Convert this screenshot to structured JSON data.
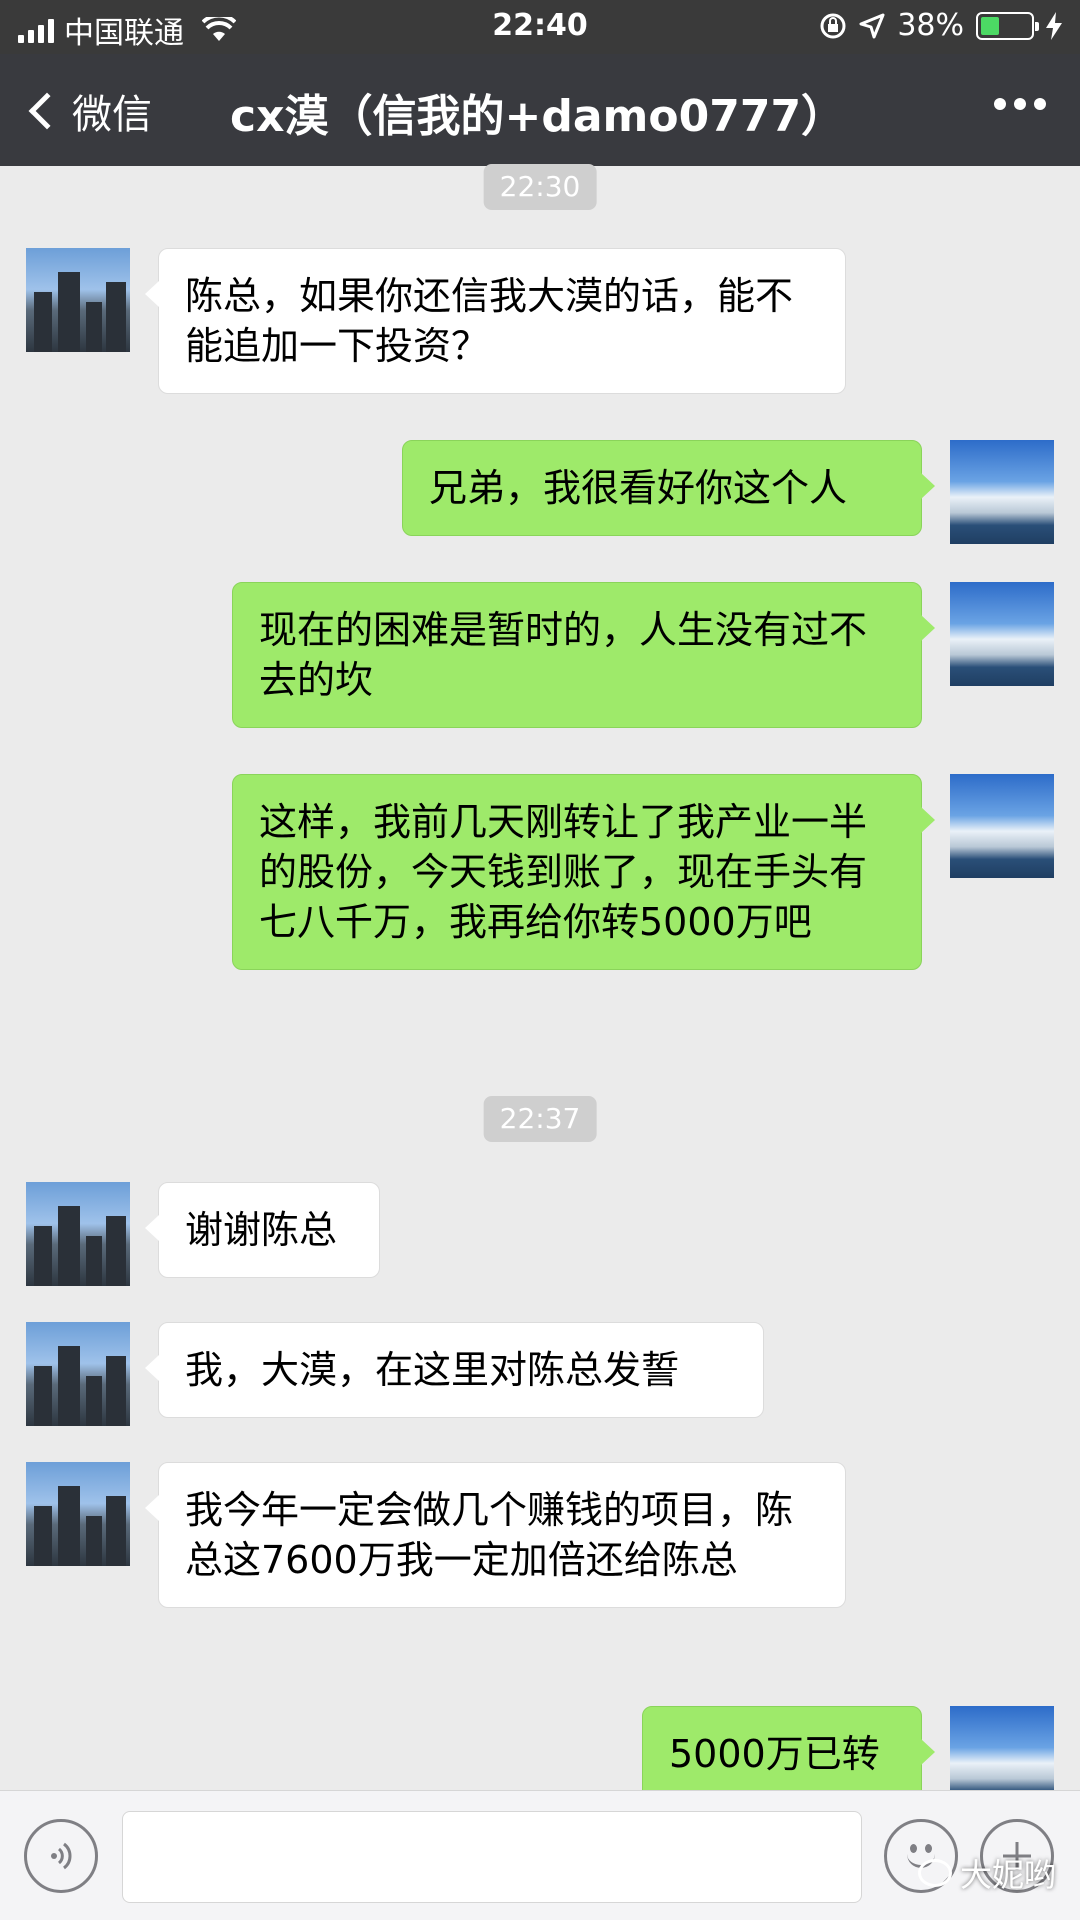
{
  "status_bar": {
    "carrier": "中国联通",
    "time": "22:40",
    "battery_percent": "38%",
    "battery_level": 0.38,
    "battery_color": "#4cd964"
  },
  "nav": {
    "back_label": "微信",
    "title": "cx漠（信我的+damo0777）"
  },
  "timestamps": [
    "22:30",
    "22:37"
  ],
  "messages": [
    {
      "side": "left",
      "text": "陈总，如果你还信我大漠的话，能不能追加一下投资？"
    },
    {
      "side": "right",
      "text": "兄弟，我很看好你这个人"
    },
    {
      "side": "right",
      "text": "现在的困难是暂时的，人生没有过不去的坎"
    },
    {
      "side": "right",
      "text": "这样，我前几天刚转让了我产业一半的股份，今天钱到账了，现在手头有七八千万，我再给你转5000万吧"
    },
    {
      "side": "left",
      "text": "谢谢陈总"
    },
    {
      "side": "left",
      "text": "我，大漠，在这里对陈总发誓"
    },
    {
      "side": "left",
      "text": "我今年一定会做几个赚钱的项目，陈总这7600万我一定加倍还给陈总"
    },
    {
      "side": "right",
      "text": "5000万已转"
    }
  ],
  "input_bar": {
    "voice_icon": "voice-icon",
    "emoji_icon": "emoji-icon",
    "plus_icon": "plus-icon"
  },
  "watermark": "大妮哟",
  "colors": {
    "nav_bg": "#393a3f",
    "chat_bg": "#ebebeb",
    "sent_bubble": "#9eea6a",
    "received_bubble": "#ffffff"
  }
}
